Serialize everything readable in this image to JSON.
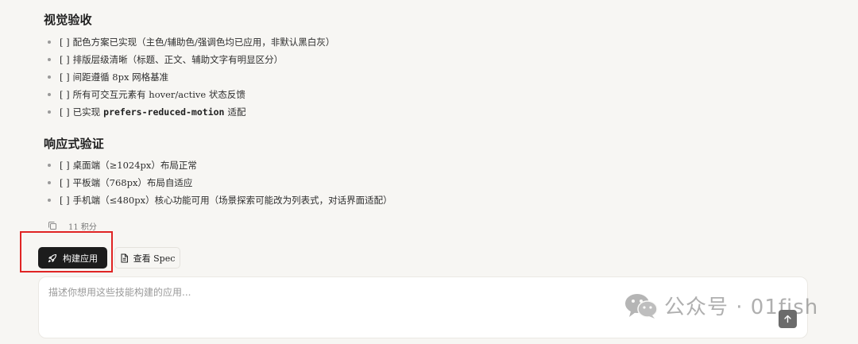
{
  "visual_section": {
    "title": "视觉验收",
    "items": [
      {
        "check": "[ ]",
        "text": "配色方案已实现（主色/辅助色/强调色均已应用，非默认黑白灰）"
      },
      {
        "check": "[ ]",
        "text": "排版层级清晰（标题、正文、辅助文字有明显区分）"
      },
      {
        "check": "[ ]",
        "text": "间距遵循 8px 网格基准"
      },
      {
        "check": "[ ]",
        "text": "所有可交互元素有 hover/active 状态反馈"
      },
      {
        "check": "[ ]",
        "text_before": "已实现",
        "code": "prefers-reduced-motion",
        "text_after": "适配"
      }
    ]
  },
  "responsive_section": {
    "title": "响应式验证",
    "items": [
      {
        "check": "[ ]",
        "text": "桌面端（≥1024px）布局正常"
      },
      {
        "check": "[ ]",
        "text": "平板端（768px）布局自适应"
      },
      {
        "check": "[ ]",
        "text": "手机端（≤480px）核心功能可用（场景探索可能改为列表式，对话界面适配）"
      }
    ]
  },
  "meta": {
    "copy_icon": "copy-icon",
    "credits": "11 积分"
  },
  "actions": {
    "build_label": "构建应用",
    "build_icon": "rocket-icon",
    "spec_label": "查看 Spec",
    "spec_icon": "document-icon"
  },
  "composer": {
    "placeholder": "描述你想用这些技能构建的应用...",
    "value": "",
    "send_icon": "arrow-up-icon"
  },
  "watermark": {
    "text": "公众号 · 01fish",
    "icon": "wechat-icon"
  },
  "colors": {
    "background": "#f7f6f3",
    "primary_button": "#1c1c1c",
    "highlight": "#e02424",
    "send_button": "#6b6b6b"
  }
}
